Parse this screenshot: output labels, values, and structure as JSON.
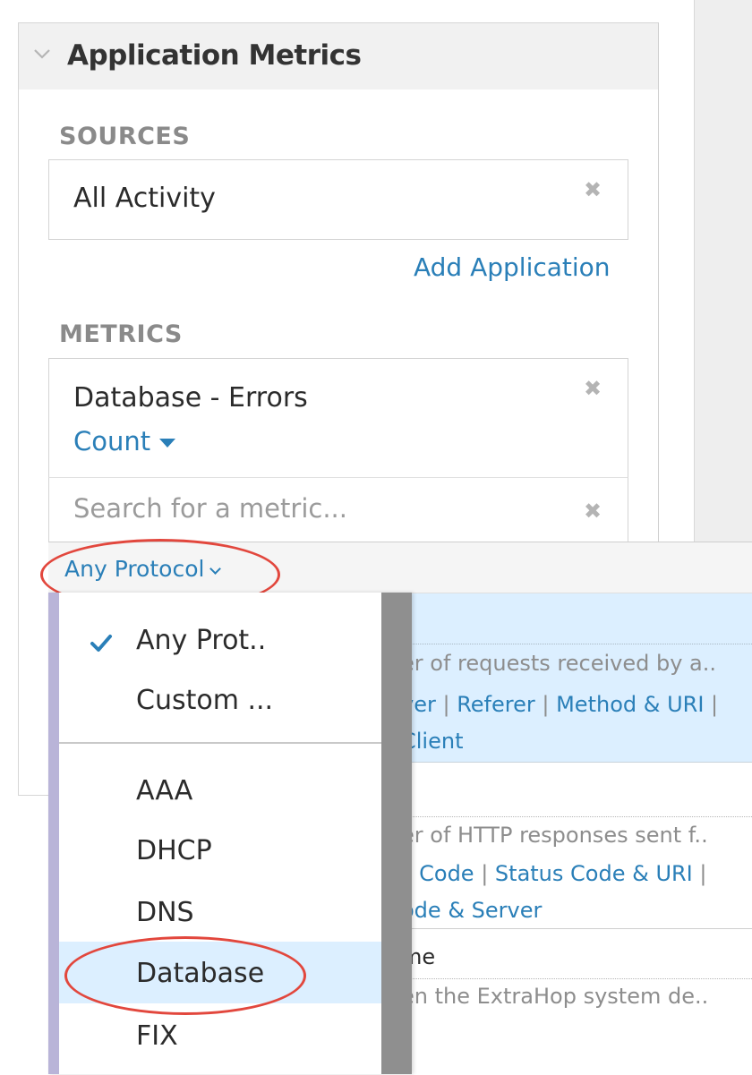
{
  "panel": {
    "title": "Application Metrics",
    "sources_label": "SOURCES",
    "metrics_label": "METRICS"
  },
  "sources": {
    "items": [
      {
        "label": "All Activity"
      }
    ],
    "add_label": "Add Application"
  },
  "metrics": {
    "selected": {
      "name": "Database - Errors",
      "aggregation": "Count"
    },
    "search": {
      "placeholder": "Search for a metric..."
    }
  },
  "protocol_filter": {
    "label": "Any Protocol"
  },
  "protocol_menu": {
    "items": [
      {
        "label": "Any Prot..",
        "checked": true
      },
      {
        "label": "Custom ..."
      },
      {
        "label": "AAA"
      },
      {
        "label": "DHCP"
      },
      {
        "label": "DNS"
      },
      {
        "label": "Database",
        "highlighted": true
      },
      {
        "label": "FIX"
      }
    ]
  },
  "results": [
    {
      "description": "er of requests received by a..",
      "links": [
        "ver",
        "Referer",
        "Method & URI"
      ],
      "links_line2": [
        "Client"
      ],
      "selected": true
    },
    {
      "description": "er of HTTP responses sent f..",
      "links": [
        "s Code",
        "Status Code & URI"
      ],
      "links_line2": [
        "ode & Server"
      ]
    },
    {
      "name": "me",
      "description": "en the ExtraHop system de.."
    }
  ],
  "colors": {
    "link": "#2a7fb8",
    "selection": "#dcefff",
    "annotation": "#e2473d"
  }
}
